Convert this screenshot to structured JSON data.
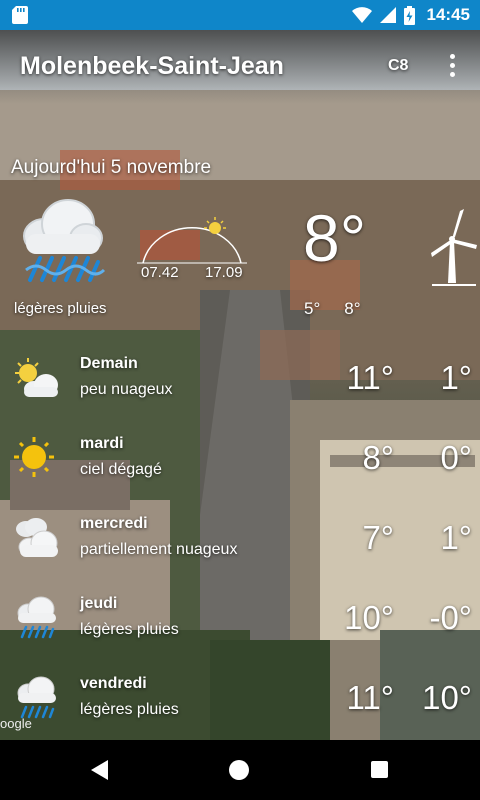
{
  "status_bar": {
    "time": "14:45"
  },
  "app_bar": {
    "title": "Molenbeek-Saint-Jean",
    "unit": "C8"
  },
  "today": {
    "date": "Aujourd'hui 5 novembre",
    "sunrise": "07.42",
    "sunset": "17.09",
    "description": "légères pluies",
    "temperature": "8°",
    "min": "5°",
    "max": "8°"
  },
  "forecast": [
    {
      "day": "Demain",
      "desc": "peu nuageux",
      "max": "11°",
      "min": "1°",
      "icon": "partly-cloudy-icon"
    },
    {
      "day": "mardi",
      "desc": "ciel dégagé",
      "max": "8°",
      "min": "0°",
      "icon": "sun-icon"
    },
    {
      "day": "mercredi",
      "desc": "partiellement nuageux",
      "max": "7°",
      "min": "1°",
      "icon": "clouds-icon"
    },
    {
      "day": "jeudi",
      "desc": "légères pluies",
      "max": "10°",
      "min": "-0°",
      "icon": "rain-icon"
    },
    {
      "day": "vendredi",
      "desc": "légères pluies",
      "max": "11°",
      "min": "10°",
      "icon": "rain-icon"
    }
  ],
  "attribution": "oogle"
}
